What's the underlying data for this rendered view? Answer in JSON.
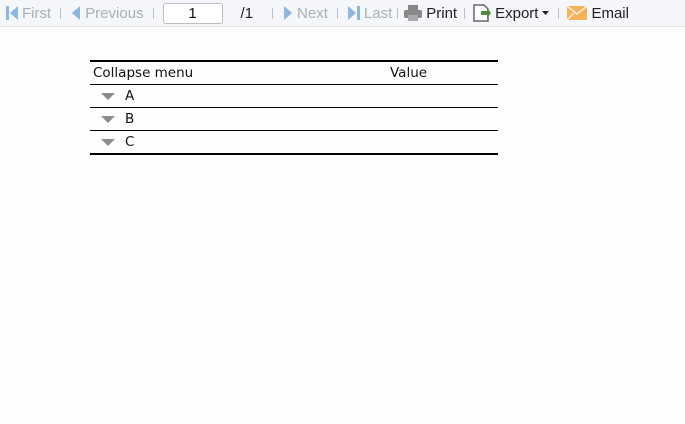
{
  "toolbar": {
    "first": "First",
    "previous": "Previous",
    "page_value": "1",
    "page_total": "/1",
    "next": "Next",
    "last": "Last",
    "print": "Print",
    "export": "Export",
    "email": "Email"
  },
  "table": {
    "headers": [
      "Collapse menu",
      "Value"
    ],
    "rows": [
      {
        "label": "A",
        "value": ""
      },
      {
        "label": "B",
        "value": ""
      },
      {
        "label": "C",
        "value": ""
      }
    ]
  }
}
